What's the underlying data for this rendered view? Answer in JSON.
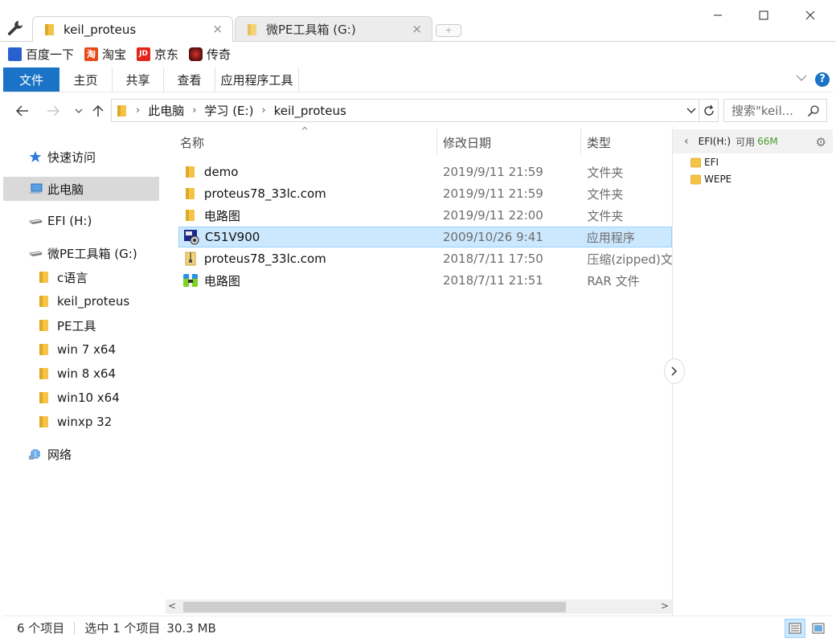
{
  "tabs": [
    {
      "label": "keil_proteus",
      "active": true
    },
    {
      "label": "微PE工具箱 (G:)",
      "active": false
    }
  ],
  "window_controls": {
    "minimize": "minimize",
    "maximize": "maximize",
    "close": "close"
  },
  "bookmarks": [
    {
      "label": "百度一下",
      "icon": "baidu-icon",
      "color": "#2b5fd0"
    },
    {
      "label": "淘宝",
      "icon": "taobao-icon",
      "color": "#e64a19"
    },
    {
      "label": "京东",
      "icon": "jd-icon",
      "color": "#e1251b"
    },
    {
      "label": "传奇",
      "icon": "game-icon",
      "color": "#5a1010"
    }
  ],
  "ribbon": {
    "tabs": [
      "文件",
      "主页",
      "共享",
      "查看",
      "应用程序工具"
    ],
    "help": "?"
  },
  "address": {
    "crumbs": [
      "此电脑",
      "学习 (E:)",
      "keil_proteus"
    ],
    "search_placeholder": "搜索\"keil..."
  },
  "nav_pane": {
    "items": [
      {
        "label": "快速访问",
        "icon": "star-icon",
        "level": 0,
        "selected": false
      },
      {
        "label": "此电脑",
        "icon": "computer-icon",
        "level": 0,
        "selected": true
      },
      {
        "label": "EFI (H:)",
        "icon": "drive-icon",
        "level": 0,
        "selected": false
      },
      {
        "label": "微PE工具箱 (G:)",
        "icon": "drive-icon",
        "level": 0,
        "selected": false
      },
      {
        "label": "c语言",
        "icon": "folder-icon",
        "level": 1,
        "selected": false
      },
      {
        "label": "keil_proteus",
        "icon": "folder-icon",
        "level": 1,
        "selected": false
      },
      {
        "label": "PE工具",
        "icon": "folder-icon",
        "level": 1,
        "selected": false
      },
      {
        "label": "win 7 x64",
        "icon": "folder-icon",
        "level": 1,
        "selected": false
      },
      {
        "label": "win 8 x64",
        "icon": "folder-icon",
        "level": 1,
        "selected": false
      },
      {
        "label": "win10 x64",
        "icon": "folder-icon",
        "level": 1,
        "selected": false
      },
      {
        "label": "winxp 32",
        "icon": "folder-icon",
        "level": 1,
        "selected": false
      },
      {
        "label": "网络",
        "icon": "network-icon",
        "level": 0,
        "selected": false
      }
    ]
  },
  "columns": {
    "name": "名称",
    "modified": "修改日期",
    "type": "类型"
  },
  "files": [
    {
      "name": "demo",
      "modified": "2019/9/11 21:59",
      "type": "文件夹",
      "icon": "folder-icon",
      "selected": false
    },
    {
      "name": "proteus78_33lc.com",
      "modified": "2019/9/11 21:59",
      "type": "文件夹",
      "icon": "folder-icon",
      "selected": false
    },
    {
      "name": "电路图",
      "modified": "2019/9/11 22:00",
      "type": "文件夹",
      "icon": "folder-icon",
      "selected": false
    },
    {
      "name": "C51V900",
      "modified": "2009/10/26 9:41",
      "type": "应用程序",
      "icon": "exe-icon",
      "selected": true
    },
    {
      "name": "proteus78_33lc.com",
      "modified": "2018/7/11 17:50",
      "type": "压缩(zipped)文件夹",
      "icon": "zip-icon",
      "selected": false
    },
    {
      "name": "电路图",
      "modified": "2018/7/11 21:51",
      "type": "RAR 文件",
      "icon": "rar-icon",
      "selected": false
    }
  ],
  "right_pane": {
    "drive": "EFI(H:)",
    "free_label": "可用",
    "free_value": "66M",
    "items": [
      "EFI",
      "WEPE"
    ]
  },
  "status": {
    "count": "6 个项目",
    "selected": "选中 1 个项目",
    "size": "30.3 MB"
  }
}
